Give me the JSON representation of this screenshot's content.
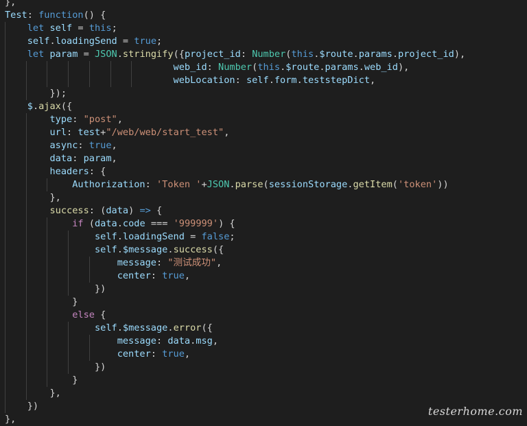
{
  "editor": {
    "lines": [
      [
        [
          "},",
          "plain"
        ]
      ],
      [
        [
          "Test",
          "key"
        ],
        [
          ": ",
          "plain"
        ],
        [
          "function",
          "kw"
        ],
        [
          "() {",
          "plain"
        ]
      ],
      [
        [
          "    ",
          "plain"
        ],
        [
          "let",
          "kw"
        ],
        [
          " ",
          "plain"
        ],
        [
          "self",
          "key"
        ],
        [
          " = ",
          "plain"
        ],
        [
          "this",
          "kw"
        ],
        [
          ";",
          "plain"
        ]
      ],
      [
        [
          "    ",
          "plain"
        ],
        [
          "self",
          "key"
        ],
        [
          ".",
          "plain"
        ],
        [
          "loadingSend",
          "key"
        ],
        [
          " = ",
          "plain"
        ],
        [
          "true",
          "kw"
        ],
        [
          ";",
          "plain"
        ]
      ],
      [
        [
          "    ",
          "plain"
        ],
        [
          "let",
          "kw"
        ],
        [
          " ",
          "plain"
        ],
        [
          "param",
          "key"
        ],
        [
          " = ",
          "plain"
        ],
        [
          "JSON",
          "type"
        ],
        [
          ".",
          "plain"
        ],
        [
          "stringify",
          "fn"
        ],
        [
          "({",
          "plain"
        ],
        [
          "project_id",
          "key"
        ],
        [
          ": ",
          "plain"
        ],
        [
          "Number",
          "type"
        ],
        [
          "(",
          "plain"
        ],
        [
          "this",
          "kw"
        ],
        [
          ".",
          "plain"
        ],
        [
          "$route",
          "key"
        ],
        [
          ".",
          "plain"
        ],
        [
          "params",
          "key"
        ],
        [
          ".",
          "plain"
        ],
        [
          "project_id",
          "key"
        ],
        [
          "),",
          "plain"
        ]
      ],
      [
        [
          "                              ",
          "plain"
        ],
        [
          "web_id",
          "key"
        ],
        [
          ": ",
          "plain"
        ],
        [
          "Number",
          "type"
        ],
        [
          "(",
          "plain"
        ],
        [
          "this",
          "kw"
        ],
        [
          ".",
          "plain"
        ],
        [
          "$route",
          "key"
        ],
        [
          ".",
          "plain"
        ],
        [
          "params",
          "key"
        ],
        [
          ".",
          "plain"
        ],
        [
          "web_id",
          "key"
        ],
        [
          "),",
          "plain"
        ]
      ],
      [
        [
          "                              ",
          "plain"
        ],
        [
          "webLocation",
          "key"
        ],
        [
          ": ",
          "plain"
        ],
        [
          "self",
          "key"
        ],
        [
          ".",
          "plain"
        ],
        [
          "form",
          "key"
        ],
        [
          ".",
          "plain"
        ],
        [
          "teststepDict",
          "key"
        ],
        [
          ",",
          "plain"
        ]
      ],
      [
        [
          "        ",
          "plain"
        ],
        [
          "});",
          "plain"
        ]
      ],
      [
        [
          "    ",
          "plain"
        ],
        [
          "$",
          "key"
        ],
        [
          ".",
          "plain"
        ],
        [
          "ajax",
          "fn"
        ],
        [
          "({",
          "plain"
        ]
      ],
      [
        [
          "        ",
          "plain"
        ],
        [
          "type",
          "key"
        ],
        [
          ": ",
          "plain"
        ],
        [
          "\"post\"",
          "str"
        ],
        [
          ",",
          "plain"
        ]
      ],
      [
        [
          "        ",
          "plain"
        ],
        [
          "url",
          "key"
        ],
        [
          ": ",
          "plain"
        ],
        [
          "test",
          "key"
        ],
        [
          "+",
          "plain"
        ],
        [
          "\"/web/web/start_test\"",
          "str"
        ],
        [
          ",",
          "plain"
        ]
      ],
      [
        [
          "        ",
          "plain"
        ],
        [
          "async",
          "key"
        ],
        [
          ": ",
          "plain"
        ],
        [
          "true",
          "kw"
        ],
        [
          ",",
          "plain"
        ]
      ],
      [
        [
          "        ",
          "plain"
        ],
        [
          "data",
          "key"
        ],
        [
          ": ",
          "plain"
        ],
        [
          "param",
          "key"
        ],
        [
          ",",
          "plain"
        ]
      ],
      [
        [
          "        ",
          "plain"
        ],
        [
          "headers",
          "key"
        ],
        [
          ": {",
          "plain"
        ]
      ],
      [
        [
          "            ",
          "plain"
        ],
        [
          "Authorization",
          "key"
        ],
        [
          ": ",
          "plain"
        ],
        [
          "'Token '",
          "str"
        ],
        [
          "+",
          "plain"
        ],
        [
          "JSON",
          "type"
        ],
        [
          ".",
          "plain"
        ],
        [
          "parse",
          "fn"
        ],
        [
          "(",
          "plain"
        ],
        [
          "sessionStorage",
          "key"
        ],
        [
          ".",
          "plain"
        ],
        [
          "getItem",
          "fn"
        ],
        [
          "(",
          "plain"
        ],
        [
          "'token'",
          "str"
        ],
        [
          "))",
          "plain"
        ]
      ],
      [
        [
          "        ",
          "plain"
        ],
        [
          "},",
          "plain"
        ]
      ],
      [
        [
          "        ",
          "plain"
        ],
        [
          "success",
          "fn"
        ],
        [
          ": (",
          "plain"
        ],
        [
          "data",
          "key"
        ],
        [
          ") ",
          "plain"
        ],
        [
          "=>",
          "kw"
        ],
        [
          " {",
          "plain"
        ]
      ],
      [
        [
          "            ",
          "plain"
        ],
        [
          "if",
          "ctrl"
        ],
        [
          " (",
          "plain"
        ],
        [
          "data",
          "key"
        ],
        [
          ".",
          "plain"
        ],
        [
          "code",
          "key"
        ],
        [
          " === ",
          "plain"
        ],
        [
          "'999999'",
          "str"
        ],
        [
          ") {",
          "plain"
        ]
      ],
      [
        [
          "                ",
          "plain"
        ],
        [
          "self",
          "key"
        ],
        [
          ".",
          "plain"
        ],
        [
          "loadingSend",
          "key"
        ],
        [
          " = ",
          "plain"
        ],
        [
          "false",
          "kw"
        ],
        [
          ";",
          "plain"
        ]
      ],
      [
        [
          "                ",
          "plain"
        ],
        [
          "self",
          "key"
        ],
        [
          ".",
          "plain"
        ],
        [
          "$message",
          "key"
        ],
        [
          ".",
          "plain"
        ],
        [
          "success",
          "fn"
        ],
        [
          "({",
          "plain"
        ]
      ],
      [
        [
          "                    ",
          "plain"
        ],
        [
          "message",
          "key"
        ],
        [
          ": ",
          "plain"
        ],
        [
          "\"测试成功\"",
          "str"
        ],
        [
          ",",
          "plain"
        ]
      ],
      [
        [
          "                    ",
          "plain"
        ],
        [
          "center",
          "key"
        ],
        [
          ": ",
          "plain"
        ],
        [
          "true",
          "kw"
        ],
        [
          ",",
          "plain"
        ]
      ],
      [
        [
          "                ",
          "plain"
        ],
        [
          "})",
          "plain"
        ]
      ],
      [
        [
          "            ",
          "plain"
        ],
        [
          "}",
          "plain"
        ]
      ],
      [
        [
          "            ",
          "plain"
        ],
        [
          "else",
          "ctrl"
        ],
        [
          " {",
          "plain"
        ]
      ],
      [
        [
          "                ",
          "plain"
        ],
        [
          "self",
          "key"
        ],
        [
          ".",
          "plain"
        ],
        [
          "$message",
          "key"
        ],
        [
          ".",
          "plain"
        ],
        [
          "error",
          "fn"
        ],
        [
          "({",
          "plain"
        ]
      ],
      [
        [
          "                    ",
          "plain"
        ],
        [
          "message",
          "key"
        ],
        [
          ": ",
          "plain"
        ],
        [
          "data",
          "key"
        ],
        [
          ".",
          "plain"
        ],
        [
          "msg",
          "key"
        ],
        [
          ",",
          "plain"
        ]
      ],
      [
        [
          "                    ",
          "plain"
        ],
        [
          "center",
          "key"
        ],
        [
          ": ",
          "plain"
        ],
        [
          "true",
          "kw"
        ],
        [
          ",",
          "plain"
        ]
      ],
      [
        [
          "                ",
          "plain"
        ],
        [
          "})",
          "plain"
        ]
      ],
      [
        [
          "            ",
          "plain"
        ],
        [
          "}",
          "plain"
        ]
      ],
      [
        [
          "        ",
          "plain"
        ],
        [
          "},",
          "plain"
        ]
      ],
      [
        [
          "    ",
          "plain"
        ],
        [
          "})",
          "plain"
        ]
      ],
      [
        [
          "},",
          "plain"
        ]
      ]
    ]
  },
  "watermark": "testerhome.com",
  "colors": {
    "background": "#1e1e1e",
    "plain": "#d4d4d4",
    "property": "#9cdcfe",
    "function": "#dcdcaa",
    "keyword": "#569cd6",
    "string": "#ce9178",
    "type": "#4ec9b0",
    "control": "#c586c0"
  }
}
